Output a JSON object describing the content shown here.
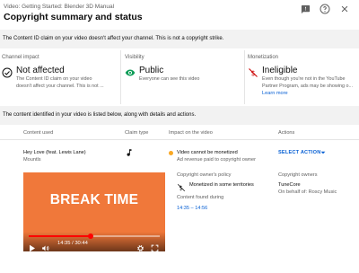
{
  "header": {
    "subtitle": "Video: Getting Started: Blender 3D Manual",
    "title": "Copyright summary and status",
    "icons": [
      "feedback-icon",
      "help-icon",
      "close-icon"
    ]
  },
  "notice": {
    "text": "The Content ID claim on your video doesn't affect your channel. This is not a copyright strike."
  },
  "cards": {
    "channel_impact": {
      "label": "Channel impact",
      "status": "Not affected",
      "desc_line1": "The Content ID claim on your video",
      "desc_line2": "doesn't affect your channel. This is not ...",
      "icon": "check-circle-outline-icon"
    },
    "visibility": {
      "label": "Visibility",
      "status": "Public",
      "desc": "Everyone can see this video",
      "icon": "eye-icon"
    },
    "monetization": {
      "label": "Monetization",
      "status": "Ineligible",
      "desc_line1": "Even though you're not in the YouTube",
      "desc_line2": "Partner Program, ads may be showing o...",
      "link": "Learn more",
      "icon": "no-money-icon",
      "icon_color": "#cc0000"
    }
  },
  "section_bar": {
    "text": "The content identified in your video is listed below, along with details and actions."
  },
  "table": {
    "headers": {
      "content_used": "Content used",
      "claim_type": "Claim type",
      "impact": "Impact on the video",
      "actions": "Actions"
    },
    "row": {
      "title": "Hey Love (feat. Lewis Lane)",
      "artist": "Mountls",
      "claim_icon": "music-note-icon",
      "impact_main": "Video cannot be monetized",
      "impact_sub": "Ad revenue paid to copyright owner",
      "impact_color": "#f9a825",
      "action_label": "SELECT ACTION"
    }
  },
  "details": {
    "policy_label": "Copyright owner's policy",
    "policy_value": "Monetized in some territories",
    "found_label": "Content found during",
    "found_value": "14:35 – 14:56",
    "owners_label": "Copyright owners",
    "owner_name": "TuneCore",
    "owner_behalf": "On behalf of: Roscy Music"
  },
  "player": {
    "overlay_text": "BREAK TIME",
    "time": "14:35 / 30:44",
    "progress_fraction": 0.475,
    "claim_range_start_fraction": 0.475,
    "claim_range_end_fraction": 0.486,
    "background_color": "#f0783a"
  }
}
